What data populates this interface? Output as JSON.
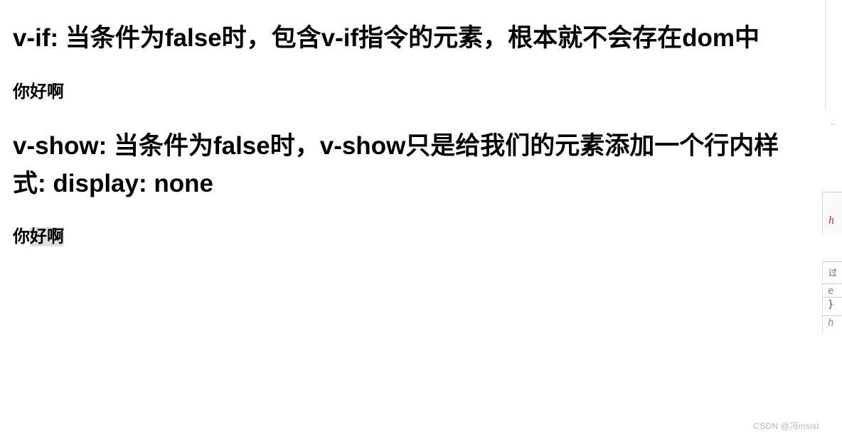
{
  "content": {
    "heading1": "v-if: 当条件为false时，包含v-if指令的元素，根本就不会存在dom中",
    "para1": "你好啊",
    "heading2": "v-show: 当条件为false时，v-show只是给我们的元素添加一个行内样式: display: none",
    "para2_prefix": "你",
    "para2_selected": "好啊"
  },
  "right_panel": {
    "dots": "··",
    "h_label": "h",
    "filter_label": "过",
    "e_label": "e",
    "brace_label": "}",
    "hi_label": "h"
  },
  "watermark": "CSDN @冯insist"
}
